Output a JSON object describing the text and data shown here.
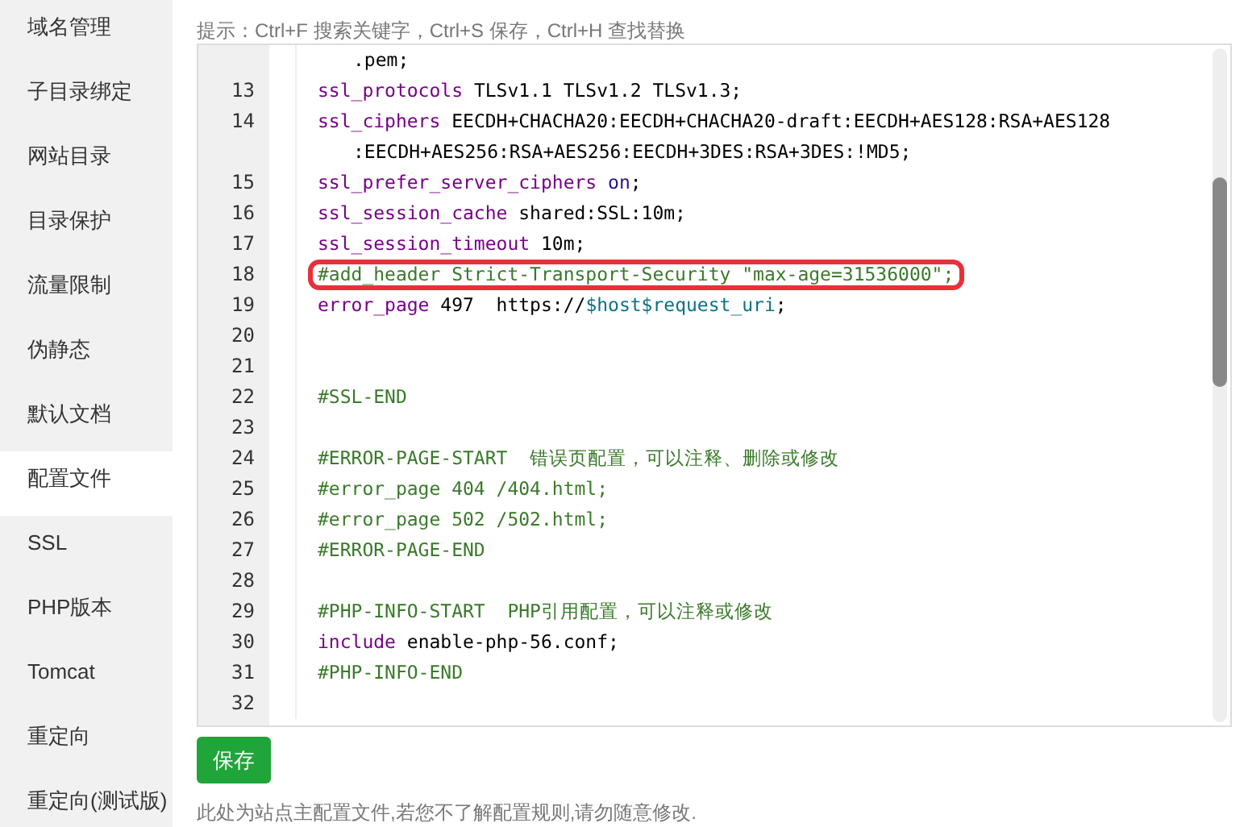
{
  "sidebar": {
    "items": [
      {
        "label": "域名管理",
        "selected": false
      },
      {
        "label": "子目录绑定",
        "selected": false
      },
      {
        "label": "网站目录",
        "selected": false
      },
      {
        "label": "目录保护",
        "selected": false
      },
      {
        "label": "流量限制",
        "selected": false
      },
      {
        "label": "伪静态",
        "selected": false
      },
      {
        "label": "默认文档",
        "selected": false
      },
      {
        "label": "配置文件",
        "selected": true
      },
      {
        "label": "SSL",
        "selected": false
      },
      {
        "label": "PHP版本",
        "selected": false
      },
      {
        "label": "Tomcat",
        "selected": false
      },
      {
        "label": "重定向",
        "selected": false
      },
      {
        "label": "重定向(测试版)",
        "selected": false
      }
    ]
  },
  "hint": "提示：Ctrl+F 搜索关键字，Ctrl+S 保存，Ctrl+H 查找替换",
  "editor": {
    "lines": [
      {
        "kind": "wrap",
        "highlighted": false,
        "segments": [
          {
            "text": ".pem;",
            "kind": "plain"
          }
        ]
      },
      {
        "kind": "line",
        "number": "13",
        "highlighted": false,
        "segments": [
          {
            "text": "ssl_protocols",
            "kind": "keyword"
          },
          {
            "text": " TLSv1.1 TLSv1.2 TLSv1.3;",
            "kind": "plain"
          }
        ]
      },
      {
        "kind": "line",
        "number": "14",
        "highlighted": false,
        "segments": [
          {
            "text": "ssl_ciphers",
            "kind": "keyword"
          },
          {
            "text": " EECDH+CHACHA20:EECDH+CHACHA20-draft:EECDH+AES128:RSA+AES128",
            "kind": "plain"
          }
        ]
      },
      {
        "kind": "wrap",
        "highlighted": false,
        "segments": [
          {
            "text": ":EECDH+AES256:RSA+AES256:EECDH+3DES:RSA+3DES:!MD5;",
            "kind": "plain"
          }
        ]
      },
      {
        "kind": "line",
        "number": "15",
        "highlighted": false,
        "segments": [
          {
            "text": "ssl_prefer_server_ciphers",
            "kind": "keyword"
          },
          {
            "text": " on",
            "kind": "atom"
          },
          {
            "text": ";",
            "kind": "plain"
          }
        ]
      },
      {
        "kind": "line",
        "number": "16",
        "highlighted": false,
        "segments": [
          {
            "text": "ssl_session_cache",
            "kind": "keyword"
          },
          {
            "text": " shared:SSL:10m;",
            "kind": "plain"
          }
        ]
      },
      {
        "kind": "line",
        "number": "17",
        "highlighted": false,
        "segments": [
          {
            "text": "ssl_session_timeout",
            "kind": "keyword"
          },
          {
            "text": " 10m;",
            "kind": "plain"
          }
        ]
      },
      {
        "kind": "line",
        "number": "18",
        "highlighted": true,
        "segments": [
          {
            "text": "#add_header Strict-Transport-Security \"max-age=31536000\";",
            "kind": "comment"
          }
        ]
      },
      {
        "kind": "line",
        "number": "19",
        "highlighted": false,
        "segments": [
          {
            "text": "error_page",
            "kind": "keyword"
          },
          {
            "text": " 497  https://",
            "kind": "plain"
          },
          {
            "text": "$host$request_uri",
            "kind": "variable"
          },
          {
            "text": ";",
            "kind": "plain"
          }
        ]
      },
      {
        "kind": "line",
        "number": "20",
        "highlighted": false
      },
      {
        "kind": "line",
        "number": "21",
        "highlighted": false
      },
      {
        "kind": "line",
        "number": "22",
        "highlighted": false,
        "segments": [
          {
            "text": "#SSL-END",
            "kind": "comment"
          }
        ]
      },
      {
        "kind": "line",
        "number": "23",
        "highlighted": false
      },
      {
        "kind": "line",
        "number": "24",
        "highlighted": false,
        "segments": [
          {
            "text": "#ERROR-PAGE-START  错误页配置，可以注释、删除或修改",
            "kind": "comment"
          }
        ]
      },
      {
        "kind": "line",
        "number": "25",
        "highlighted": false,
        "segments": [
          {
            "text": "#error_page 404 /404.html;",
            "kind": "comment"
          }
        ]
      },
      {
        "kind": "line",
        "number": "26",
        "highlighted": false,
        "segments": [
          {
            "text": "#error_page 502 /502.html;",
            "kind": "comment"
          }
        ]
      },
      {
        "kind": "line",
        "number": "27",
        "highlighted": false,
        "segments": [
          {
            "text": "#ERROR-PAGE-END",
            "kind": "comment"
          }
        ]
      },
      {
        "kind": "line",
        "number": "28",
        "highlighted": false
      },
      {
        "kind": "line",
        "number": "29",
        "highlighted": false,
        "segments": [
          {
            "text": "#PHP-INFO-START  PHP引用配置，可以注释或修改",
            "kind": "comment"
          }
        ]
      },
      {
        "kind": "line",
        "number": "30",
        "highlighted": false,
        "segments": [
          {
            "text": "include",
            "kind": "keyword"
          },
          {
            "text": " enable-php-56.conf;",
            "kind": "plain"
          }
        ]
      },
      {
        "kind": "line",
        "number": "31",
        "highlighted": false,
        "segments": [
          {
            "text": "#PHP-INFO-END",
            "kind": "comment"
          }
        ]
      },
      {
        "kind": "line",
        "number": "32",
        "highlighted": false
      }
    ]
  },
  "save_button": "保存",
  "footer_note": "此处为站点主配置文件,若您不了解配置规则,请勿随意修改."
}
